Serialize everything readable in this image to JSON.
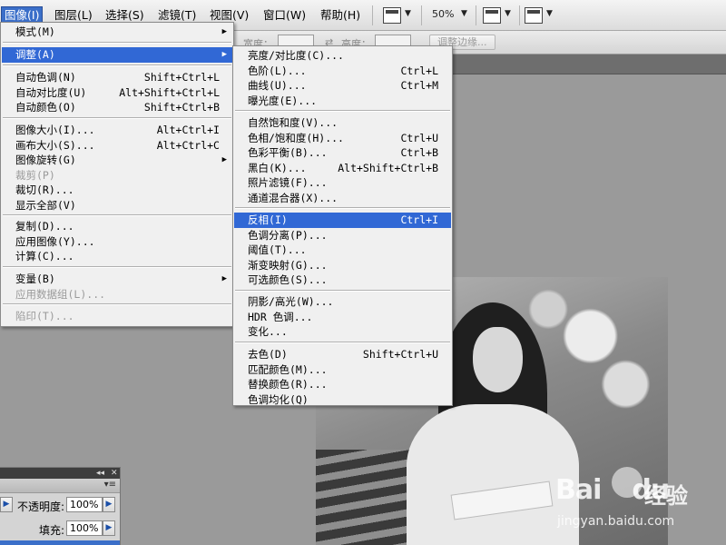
{
  "menubar": {
    "items": [
      {
        "label": "图像(I)",
        "active": true
      },
      {
        "label": "图层(L)"
      },
      {
        "label": "选择(S)"
      },
      {
        "label": "滤镜(T)"
      },
      {
        "label": "视图(V)"
      },
      {
        "label": "窗口(W)"
      },
      {
        "label": "帮助(H)"
      }
    ],
    "zoom": "50%",
    "dropdown_glyph": "▼"
  },
  "optionsbar": {
    "width_label": "宽度：",
    "height_label": "高度：",
    "refine_edge_button": "调整边缘..."
  },
  "image_menu": {
    "groups": [
      [
        {
          "label": "模式(M)",
          "submenu": true
        }
      ],
      [
        {
          "label": "调整(A)",
          "submenu": true,
          "highlight": true
        }
      ],
      [
        {
          "label": "自动色调(N)",
          "shortcut": "Shift+Ctrl+L"
        },
        {
          "label": "自动对比度(U)",
          "shortcut": "Alt+Shift+Ctrl+L"
        },
        {
          "label": "自动颜色(O)",
          "shortcut": "Shift+Ctrl+B"
        }
      ],
      [
        {
          "label": "图像大小(I)...",
          "shortcut": "Alt+Ctrl+I"
        },
        {
          "label": "画布大小(S)...",
          "shortcut": "Alt+Ctrl+C"
        },
        {
          "label": "图像旋转(G)",
          "submenu": true
        },
        {
          "label": "裁剪(P)",
          "disabled": true
        },
        {
          "label": "裁切(R)..."
        },
        {
          "label": "显示全部(V)"
        }
      ],
      [
        {
          "label": "复制(D)..."
        },
        {
          "label": "应用图像(Y)..."
        },
        {
          "label": "计算(C)..."
        }
      ],
      [
        {
          "label": "变量(B)",
          "submenu": true
        },
        {
          "label": "应用数据组(L)...",
          "disabled": true
        }
      ],
      [
        {
          "label": "陷印(T)...",
          "disabled": true
        }
      ]
    ]
  },
  "adjust_menu": {
    "groups": [
      [
        {
          "label": "亮度/对比度(C)..."
        },
        {
          "label": "色阶(L)...",
          "shortcut": "Ctrl+L"
        },
        {
          "label": "曲线(U)...",
          "shortcut": "Ctrl+M"
        },
        {
          "label": "曝光度(E)..."
        }
      ],
      [
        {
          "label": "自然饱和度(V)..."
        },
        {
          "label": "色相/饱和度(H)...",
          "shortcut": "Ctrl+U"
        },
        {
          "label": "色彩平衡(B)...",
          "shortcut": "Ctrl+B"
        },
        {
          "label": "黑白(K)...",
          "shortcut": "Alt+Shift+Ctrl+B"
        },
        {
          "label": "照片滤镜(F)..."
        },
        {
          "label": "通道混合器(X)..."
        }
      ],
      [
        {
          "label": "反相(I)",
          "shortcut": "Ctrl+I",
          "highlight": true
        },
        {
          "label": "色调分离(P)..."
        },
        {
          "label": "阈值(T)..."
        },
        {
          "label": "渐变映射(G)..."
        },
        {
          "label": "可选颜色(S)..."
        }
      ],
      [
        {
          "label": "阴影/高光(W)..."
        },
        {
          "label": "HDR 色调..."
        },
        {
          "label": "变化..."
        }
      ],
      [
        {
          "label": "去色(D)",
          "shortcut": "Shift+Ctrl+U"
        },
        {
          "label": "匹配颜色(M)..."
        },
        {
          "label": "替换颜色(R)..."
        },
        {
          "label": "色调均化(Q)"
        }
      ]
    ]
  },
  "layers_panel": {
    "header_buttons": [
      "◂◂",
      "✕"
    ],
    "menu_glyph": "▾≡",
    "opacity_label": "不透明度:",
    "opacity_value": "100%",
    "fill_label": "填充:",
    "fill_value": "100%",
    "arrow_glyph": "▶"
  },
  "watermark": {
    "logo": "Bai",
    "logo_suffix": "du",
    "cn_text": "经验",
    "url": "jingyan.baidu.com"
  }
}
